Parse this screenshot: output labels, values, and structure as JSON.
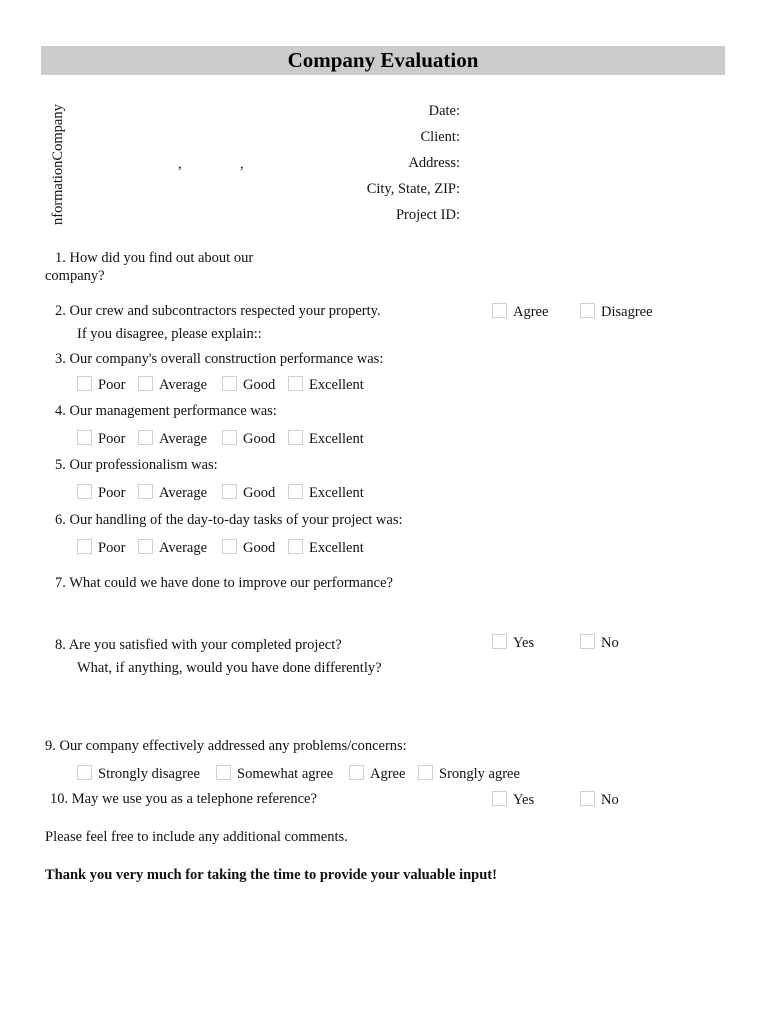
{
  "title": "Company Evaluation",
  "sidebar_label": "nformationCompany",
  "info": {
    "commas": [
      ",",
      ","
    ],
    "fields": [
      {
        "label": "Date:"
      },
      {
        "label": "Client:"
      },
      {
        "label": "Address:"
      },
      {
        "label": "City, State, ZIP:"
      },
      {
        "label": "Project ID:"
      }
    ]
  },
  "questions": {
    "q1": {
      "line1": "1.  How did you find out about our",
      "line2": "company?"
    },
    "q2": {
      "text": "2.  Our crew and subcontractors respected your property.",
      "sub": "If you disagree, please explain::",
      "options": [
        "Agree",
        "Disagree"
      ]
    },
    "q3": {
      "text": "3.  Our company's overall construction performance was:",
      "options": [
        "Poor",
        "Average",
        "Good",
        "Excellent"
      ]
    },
    "q4": {
      "text": "4.  Our management performance was:",
      "options": [
        "Poor",
        "Average",
        "Good",
        "Excellent"
      ]
    },
    "q5": {
      "text": "5.  Our professionalism was:",
      "options": [
        "Poor",
        "Average",
        "Good",
        "Excellent"
      ]
    },
    "q6": {
      "text": "6.  Our handling of the day-to-day tasks of your project was:",
      "options": [
        "Poor",
        "Average",
        "Good",
        "Excellent"
      ]
    },
    "q7": {
      "text": "7.  What could we have done to improve our performance?"
    },
    "q8": {
      "text": "8.  Are you satisfied with your completed project?",
      "sub": "What, if anything, would you have done differently?",
      "options": [
        "Yes",
        "No"
      ]
    },
    "q9": {
      "text": "9.  Our company effectively addressed any problems/concerns:",
      "options": [
        "Strongly disagree",
        "Somewhat agree",
        "Agree",
        "Srongly agree"
      ]
    },
    "q10": {
      "text": "10. May we use you as a telephone reference?",
      "options": [
        "Yes",
        "No"
      ]
    }
  },
  "comments_note": "Please feel free to include any additional comments.",
  "thank_you": "Thank you very much for taking the time to provide your valuable input!"
}
